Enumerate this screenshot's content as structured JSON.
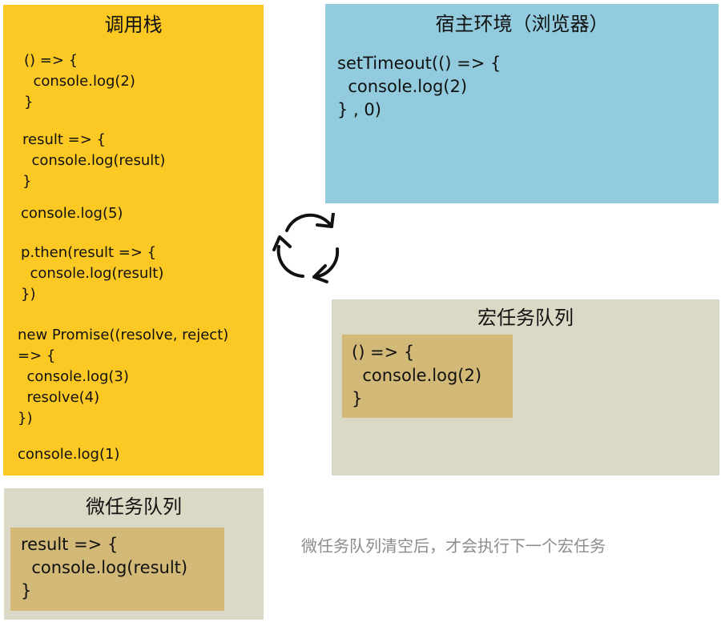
{
  "call_stack": {
    "title": "调用栈",
    "blocks": [
      "() => {\n  console.log(2)\n}",
      "result => {\n  console.log(result)\n}",
      "console.log(5)",
      "p.then(result => {\n  console.log(result)\n})",
      "new Promise((resolve, reject)\n=> {\n  console.log(3)\n  resolve(4)\n})",
      "console.log(1)"
    ]
  },
  "host_env": {
    "title": "宿主环境（浏览器）",
    "code": "setTimeout(() => {\n  console.log(2)\n} , 0)"
  },
  "macro_queue": {
    "title": "宏任务队列",
    "code": "() => {\n  console.log(2)\n}"
  },
  "micro_queue": {
    "title": "微任务队列",
    "code": "result => {\n  console.log(result)\n}"
  },
  "note": "微任务队列清空后，才会执行下一个宏任务",
  "colors": {
    "call_stack_bg": "#fcc823",
    "host_env_bg": "#92cbdd",
    "queue_bg": "#dbd9c6",
    "queue_item_bg": "#d2b978",
    "note_text": "#8c8c8c",
    "loop_arrow": "#111111"
  },
  "icons": {
    "event_loop": "cycle-arrows-icon"
  }
}
